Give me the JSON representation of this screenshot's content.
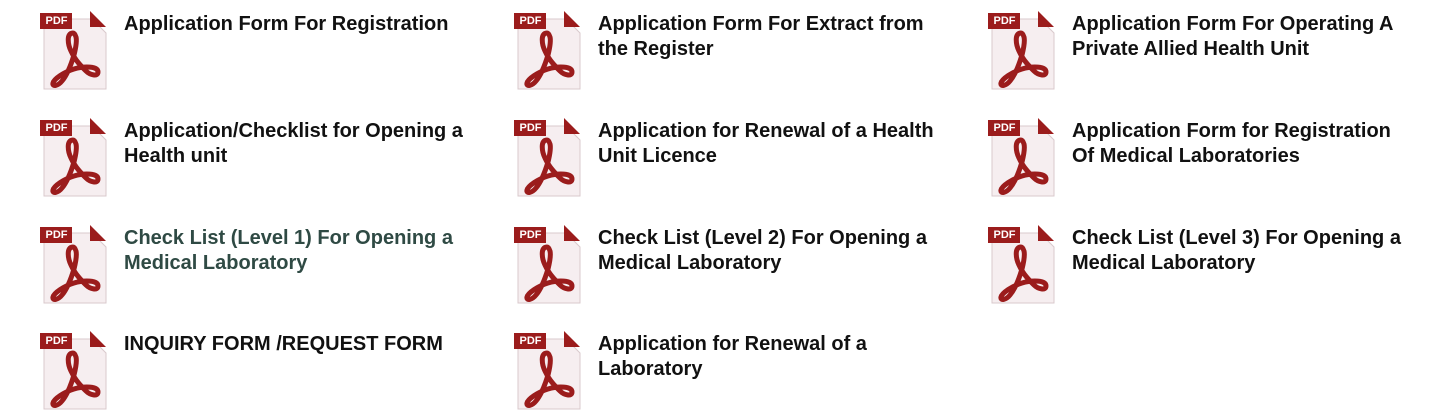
{
  "icon": {
    "name": "pdf-file-icon",
    "badge_text": "PDF",
    "accent_color": "#9b1c1c",
    "sheet_color": "#f6eef0"
  },
  "colors": {
    "title": "#111111",
    "visited_title": "#2f4a44"
  },
  "documents": [
    {
      "title": "Application Form For Registration",
      "visited": false
    },
    {
      "title": "Application Form For Extract from the Register",
      "visited": false
    },
    {
      "title": "Application Form For Operating A Private Allied Health Unit",
      "visited": false
    },
    {
      "title": "Application/Checklist for Opening a Health unit",
      "visited": false
    },
    {
      "title": "Application for Renewal of a Health Unit Licence",
      "visited": false
    },
    {
      "title": "Application Form for Registration Of Medical Laboratories",
      "visited": false
    },
    {
      "title": "Check List (Level 1) For Opening a Medical Laboratory",
      "visited": true
    },
    {
      "title": "Check List (Level 2) For Opening a Medical Laboratory",
      "visited": false
    },
    {
      "title": "Check List (Level 3) For Opening a Medical Laboratory",
      "visited": false
    },
    {
      "title": "INQUIRY FORM /REQUEST FORM",
      "visited": false
    },
    {
      "title": "Application for Renewal of a Laboratory",
      "visited": false
    }
  ]
}
